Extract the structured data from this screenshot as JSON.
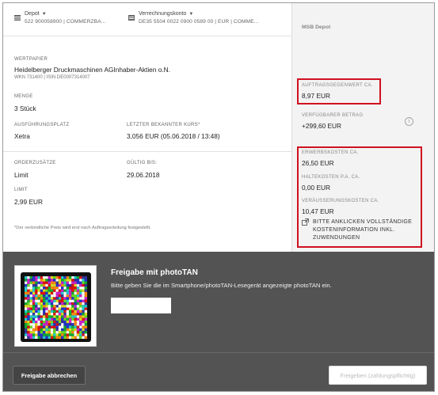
{
  "accounts": {
    "depot": {
      "label": "Depot",
      "number": "522 900058900 | COMMERZBA..."
    },
    "clearing": {
      "label": "Verrechnungskonto",
      "number": "DE35 5504 0022 0900 0589 00 | EUR | COMME..."
    }
  },
  "security": {
    "label": "WERTPAPIER",
    "name": "Heidelberger Druckmaschinen AGInhaber-Aktien o.N.",
    "ids": "WKN 731400 | ISIN DE0007314007"
  },
  "quantity": {
    "label": "MENGE",
    "value": "3 Stück"
  },
  "venue": {
    "label": "AUSFÜHRUNGSPLATZ",
    "value": "Xetra"
  },
  "last_price": {
    "label": "LETZTER BEKANNTER KURS*",
    "value": "3,056 EUR (05.06.2018 / 13:48)"
  },
  "order_add": {
    "label": "ORDERZUSÄTZE",
    "value": "Limit"
  },
  "valid_until": {
    "label": "GÜLTIG BIS:",
    "value": "29.06.2018"
  },
  "limit": {
    "label": "LIMIT",
    "value": "2,99 EUR"
  },
  "footnote": "*Der verbindliche Preis wird erst nach Auftragserteilung festgestellt.",
  "sidebar": {
    "title": "MSB Depot",
    "order_value": {
      "label": "AUFTRAGSGEGENWERT CA.",
      "value": "8,97 EUR"
    },
    "available": {
      "label": "VERFÜGBARER BETRAG",
      "value": "+299,60 EUR"
    },
    "acquisition": {
      "label": "ERWERBSKOSTEN CA.",
      "value": "26,50 EUR"
    },
    "holding": {
      "label": "HALTEKOSTEN P.A. CA.",
      "value": "0,00 EUR"
    },
    "sale": {
      "label": "VERÄUSSERUNGSKOSTEN CA.",
      "value": "10,47 EUR"
    },
    "link": "BITTE ANKLICKEN VOLLSTÄNDIGE KOSTENINFORMATION INKL. ZUWENDUNGEN"
  },
  "phototan": {
    "title": "Freigabe mit photoTAN",
    "description": "Bitte geben Sie die im Smartphone/photoTAN-Lesegerät angezeigte photoTAN ein.",
    "input_value": "",
    "input_placeholder": ""
  },
  "buttons": {
    "cancel": "Freigabe abbrechen",
    "release": "Freigeben (zahlungspflichtig)"
  },
  "colors": {
    "highlight": "#d01020",
    "panel": "#535353",
    "sidebar_bg": "#f3f3f3"
  },
  "icons": [
    "depot-icon",
    "account-icon",
    "info-icon",
    "external-link-icon",
    "phototan-code"
  ]
}
